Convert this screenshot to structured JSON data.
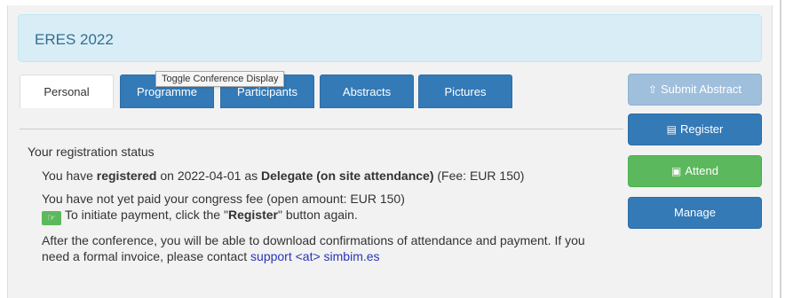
{
  "conference": {
    "title": "ERES 2022"
  },
  "tabs": [
    {
      "label": "Personal",
      "active": true
    },
    {
      "label": "Programme",
      "active": false
    },
    {
      "label": "Participants",
      "active": false
    },
    {
      "label": "Abstracts",
      "active": false
    },
    {
      "label": "Pictures",
      "active": false
    }
  ],
  "tooltip": "Toggle Conference Display",
  "sidebar": {
    "submit_abstract": "Submit Abstract",
    "register": "Register",
    "attend": "Attend",
    "manage": "Manage"
  },
  "registration": {
    "title": "Your registration status",
    "line1_prefix": "You have ",
    "line1_bold": "registered",
    "line1_mid": " on 2022-04-01 as ",
    "line1_role": "Delegate (on site attendance)",
    "line1_suffix": " (Fee: EUR 150)",
    "line2": "You have not yet paid your congress fee (open amount: EUR 150)",
    "line3_prefix": "To initiate payment, click the \"",
    "line3_bold": "Register",
    "line3_suffix": "\" button again.",
    "line4": "After the conference, you will be able to download confirmations of attendance and payment. If you need a formal invoice, please contact ",
    "support_link": "support <at> simbim.es"
  },
  "colors": {
    "primary": "#337ab7",
    "success": "#5cb85c",
    "info_bg": "#d9edf7",
    "link": "#2a35b8"
  }
}
